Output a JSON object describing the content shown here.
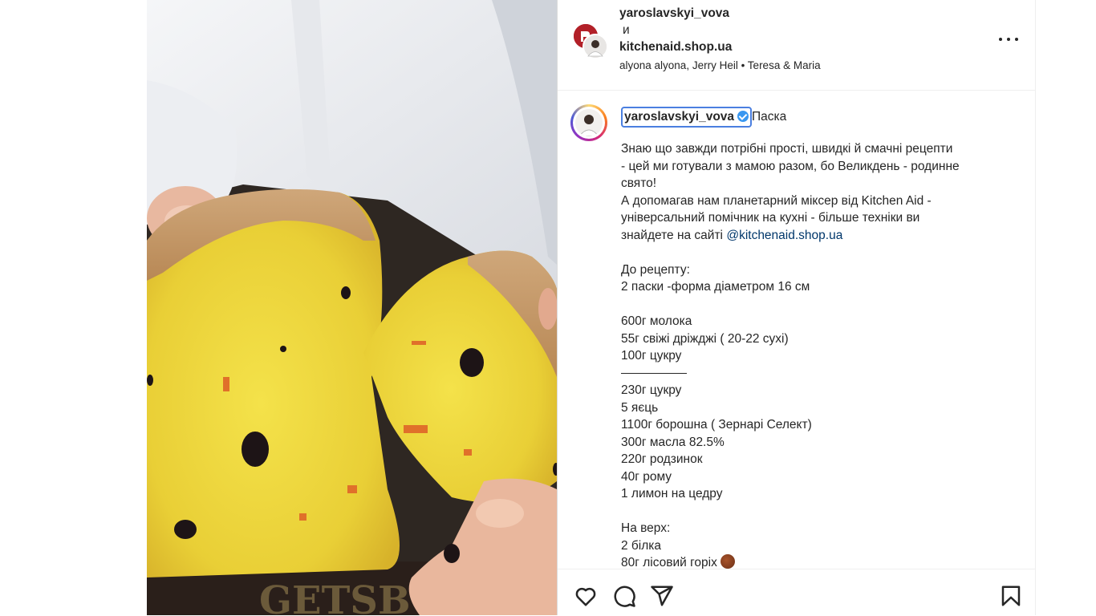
{
  "post": {
    "header": {
      "user_primary": "yaroslavskyi_vova",
      "conjunction": "и",
      "user_collab": "kitchenaid.shop.ua",
      "audio": "alyona alyona, Jerry Heil • Teresa & Maria"
    },
    "caption": {
      "username": "yaroslavskyi_vova",
      "title": "Паска",
      "lines": [
        "Знаю що завжди потрібні прості, швидкі й смачні рецепти",
        "- цей ми готували з мамою разом, бо Великдень - родинне",
        "свято!",
        "А допомагав нам планетарний міксер від Kitchen Aid -",
        "універсальний помічник на кухні - більше техніки ви",
        "знайдете на сайті",
        "@kitchenaid.shop.ua",
        "До рецепту:",
        "2 паски -форма діаметром 16 см",
        "600г молока",
        "55г свіжі дріжджі ( 20-22 сухі)",
        "100г цукру",
        "230г цукру",
        "5 яєць",
        "1100г борошна ( Зернарі Селект)",
        "300г масла 82.5%",
        "220г родзинок",
        "40г рому",
        "1 лимон на цедру",
        "На верх:",
        "2 білка",
        "80г лісовий горіх"
      ]
    },
    "icons": {
      "more": "more-options-icon",
      "like": "heart-icon",
      "comment": "comment-icon",
      "share": "share-icon",
      "save": "bookmark-icon",
      "verified": "verified-badge-icon",
      "hazelnut_emoji": "hazelnut-emoji-icon"
    },
    "colors": {
      "mention": "#00376b",
      "verified": "#3897f0",
      "focus_outline": "#4a7fe0"
    }
  }
}
